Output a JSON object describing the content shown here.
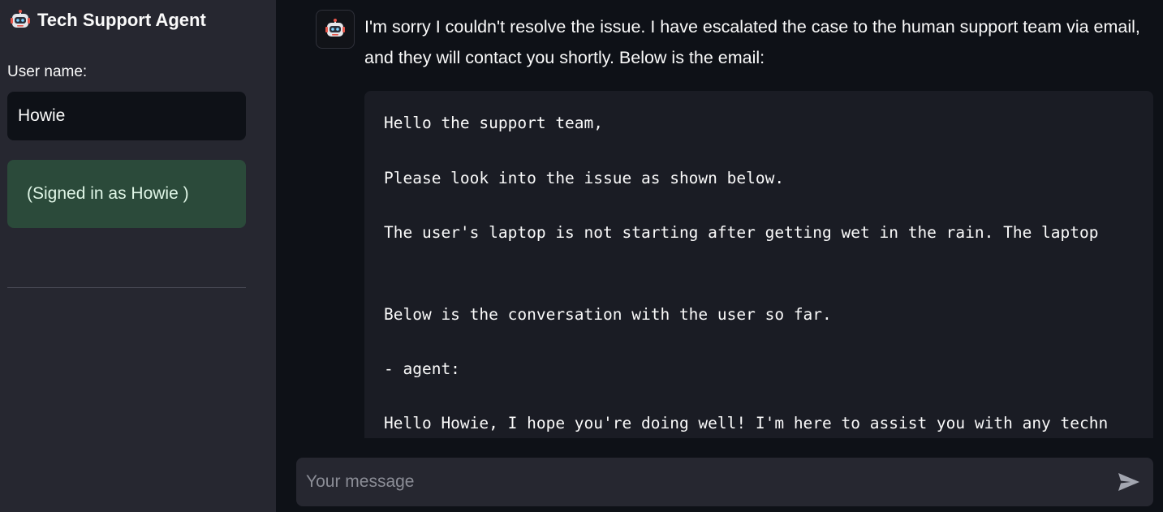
{
  "sidebar": {
    "title": "Tech Support Agent",
    "title_icon": "robot-icon",
    "username_label": "User name:",
    "username_value": "Howie",
    "signed_in_text": "(Signed in as Howie )"
  },
  "chat": {
    "assistant_icon": "robot-icon",
    "message": "I'm sorry I couldn't resolve the issue. I have escalated the case to the human support team via email, and they will contact you shortly. Below is the email:",
    "email_lines": [
      "Hello the support team,",
      "Please look into the issue as shown below.",
      "The user's laptop is not starting after getting wet in the rain. The laptop",
      "Below is the conversation with the user so far.",
      "- agent:",
      "Hello Howie, I hope you're doing well! I'm here to assist you with any techn"
    ],
    "input_placeholder": "Your message",
    "send_icon": "send-icon"
  },
  "colors": {
    "sidebar_bg": "#262730",
    "main_bg": "#0e1117",
    "success_bg": "#2b4a3a",
    "code_bg": "#1a1c24"
  }
}
